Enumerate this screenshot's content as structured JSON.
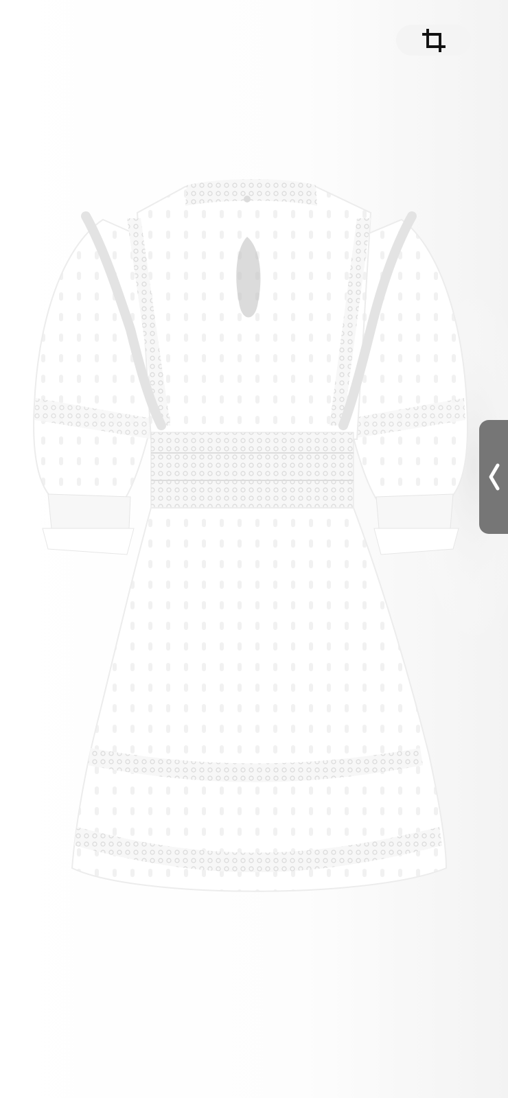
{
  "toolbar": {
    "crop_icon": "crop-icon"
  },
  "panel": {
    "handle_icon": "chevron-left-icon"
  },
  "image": {
    "subject": "white-lace-dress-back-view"
  },
  "colors": {
    "button_bg": "#f4f4f4",
    "handle_bg": "#767676",
    "dress": "#ffffff",
    "lace": "#e6e6e6"
  }
}
